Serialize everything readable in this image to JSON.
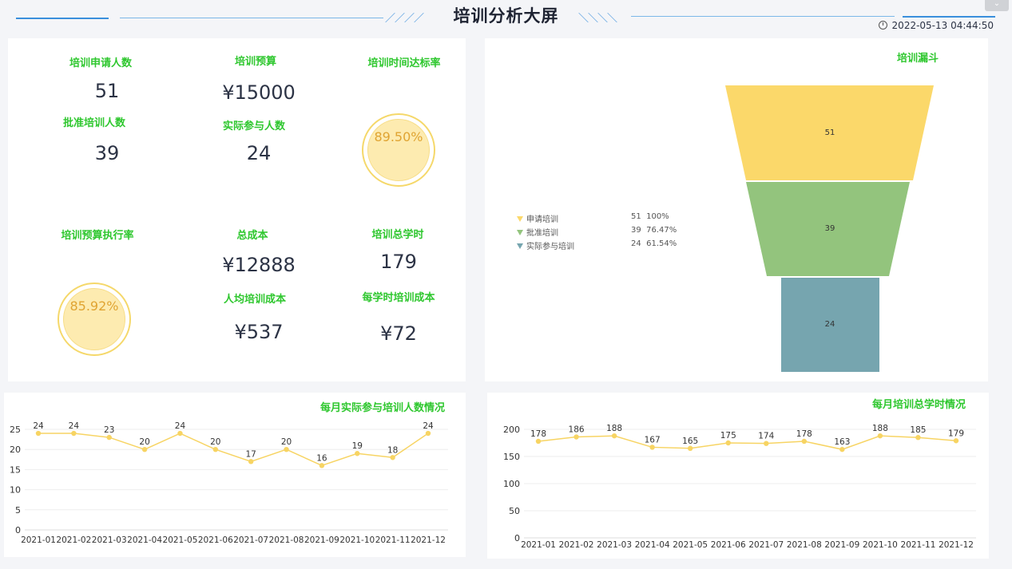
{
  "header": {
    "title": "培训分析大屏",
    "datetime": "2022-05-13 04:44:50"
  },
  "kpis": {
    "applicants": {
      "label": "培训申请人数",
      "value": "51"
    },
    "budget": {
      "label": "培训预算",
      "value": "¥15000"
    },
    "on_time_rate": {
      "label": "培训时间达标率",
      "value": "89.50%"
    },
    "approved": {
      "label": "批准培训人数",
      "value": "39"
    },
    "participants": {
      "label": "实际参与人数",
      "value": "24"
    },
    "budget_exec_rate": {
      "label": "培训预算执行率",
      "value": "85.92%"
    },
    "total_cost": {
      "label": "总成本",
      "value": "¥12888"
    },
    "total_hours": {
      "label": "培训总学时",
      "value": "179"
    },
    "cost_per_person": {
      "label": "人均培训成本",
      "value": "¥537"
    },
    "cost_per_hour": {
      "label": "每学时培训成本",
      "value": "¥72"
    }
  },
  "funnel": {
    "title": "培训漏斗",
    "colors": [
      "#fbd86a",
      "#93c47d",
      "#76a5af"
    ],
    "legend": [
      {
        "name": "申请培训",
        "value": "51",
        "pct": "100%"
      },
      {
        "name": "批准培训",
        "value": "39",
        "pct": "76.47%"
      },
      {
        "name": "实际参与培训",
        "value": "24",
        "pct": "61.54%"
      }
    ],
    "values": [
      51,
      39,
      24
    ]
  },
  "chart_data": [
    {
      "type": "line",
      "title": "每月实际参与培训人数情况",
      "categories": [
        "2021-01",
        "2021-02",
        "2021-03",
        "2021-04",
        "2021-05",
        "2021-06",
        "2021-07",
        "2021-08",
        "2021-09",
        "2021-10",
        "2021-11",
        "2021-12"
      ],
      "values": [
        24,
        24,
        23,
        20,
        24,
        20,
        17,
        20,
        16,
        19,
        18,
        24
      ],
      "ylim": [
        0,
        25
      ],
      "yticks": [
        0,
        5,
        10,
        15,
        20,
        25
      ],
      "color": "#f7d463",
      "grid": true
    },
    {
      "type": "line",
      "title": "每月培训总学时情况",
      "categories": [
        "2021-01",
        "2021-02",
        "2021-03",
        "2021-04",
        "2021-05",
        "2021-06",
        "2021-07",
        "2021-08",
        "2021-09",
        "2021-10",
        "2021-11",
        "2021-12"
      ],
      "values": [
        178,
        186,
        188,
        167,
        165,
        175,
        174,
        178,
        163,
        188,
        185,
        179
      ],
      "ylim": [
        0,
        200
      ],
      "yticks": [
        0,
        50,
        100,
        150,
        200
      ],
      "color": "#f7d463",
      "grid": true
    }
  ]
}
